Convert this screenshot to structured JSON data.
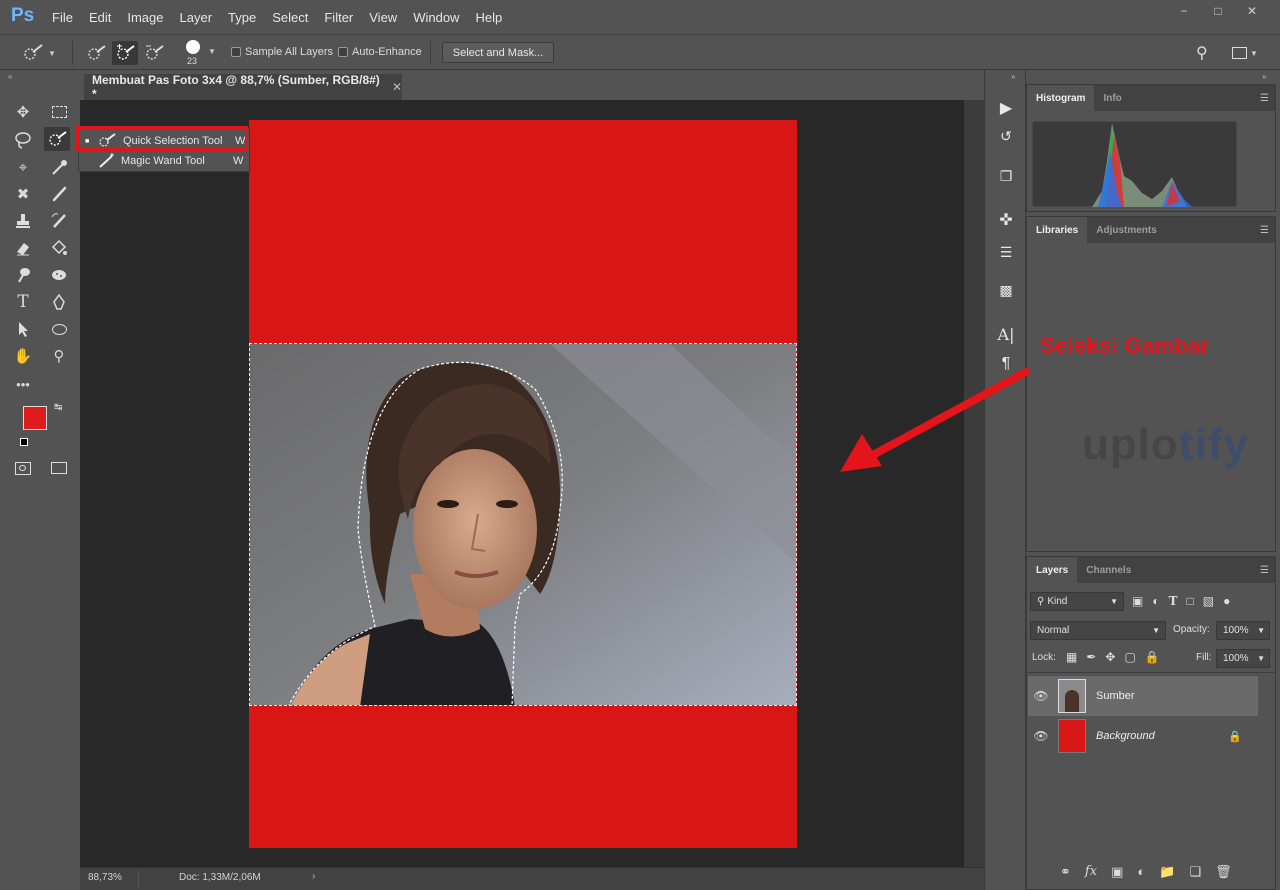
{
  "app": {
    "logo": "Ps",
    "menu": [
      "File",
      "Edit",
      "Image",
      "Layer",
      "Type",
      "Select",
      "Filter",
      "View",
      "Window",
      "Help"
    ],
    "window_buttons": [
      "−",
      "□",
      "✕"
    ]
  },
  "options": {
    "brush_size": "23",
    "sample_all_layers": "Sample All Layers",
    "auto_enhance": "Auto-Enhance",
    "select_and_mask": "Select and Mask..."
  },
  "document": {
    "tab_title": "Membuat Pas Foto 3x4 @ 88,7% (Sumber, RGB/8#) *",
    "zoom": "88,73%",
    "doc_info": "Doc: 1,33M/2,06M"
  },
  "flyout": {
    "items": [
      {
        "label": "Quick Selection Tool",
        "key": "W"
      },
      {
        "label": "Magic Wand Tool",
        "key": "W"
      }
    ]
  },
  "panels": {
    "top_tabs": [
      "Histogram",
      "Info"
    ],
    "mid_tabs": [
      "Libraries",
      "Adjustments"
    ],
    "layer_tabs": [
      "Layers",
      "Channels"
    ],
    "filter_kind": "Kind",
    "blend_mode": "Normal",
    "opacity_label": "Opacity:",
    "opacity_value": "100%",
    "lock_label": "Lock:",
    "fill_label": "Fill:",
    "fill_value": "100%",
    "layers": [
      {
        "name": "Sumber"
      },
      {
        "name": "Background"
      }
    ]
  },
  "annotation": {
    "text": "Seleksi Gambar"
  },
  "watermark": {
    "part1": "uplo",
    "part2": "tify"
  },
  "colors": {
    "foreground": "#e01b1b",
    "background": "#1e8fff",
    "canvas_red": "#d91616"
  }
}
